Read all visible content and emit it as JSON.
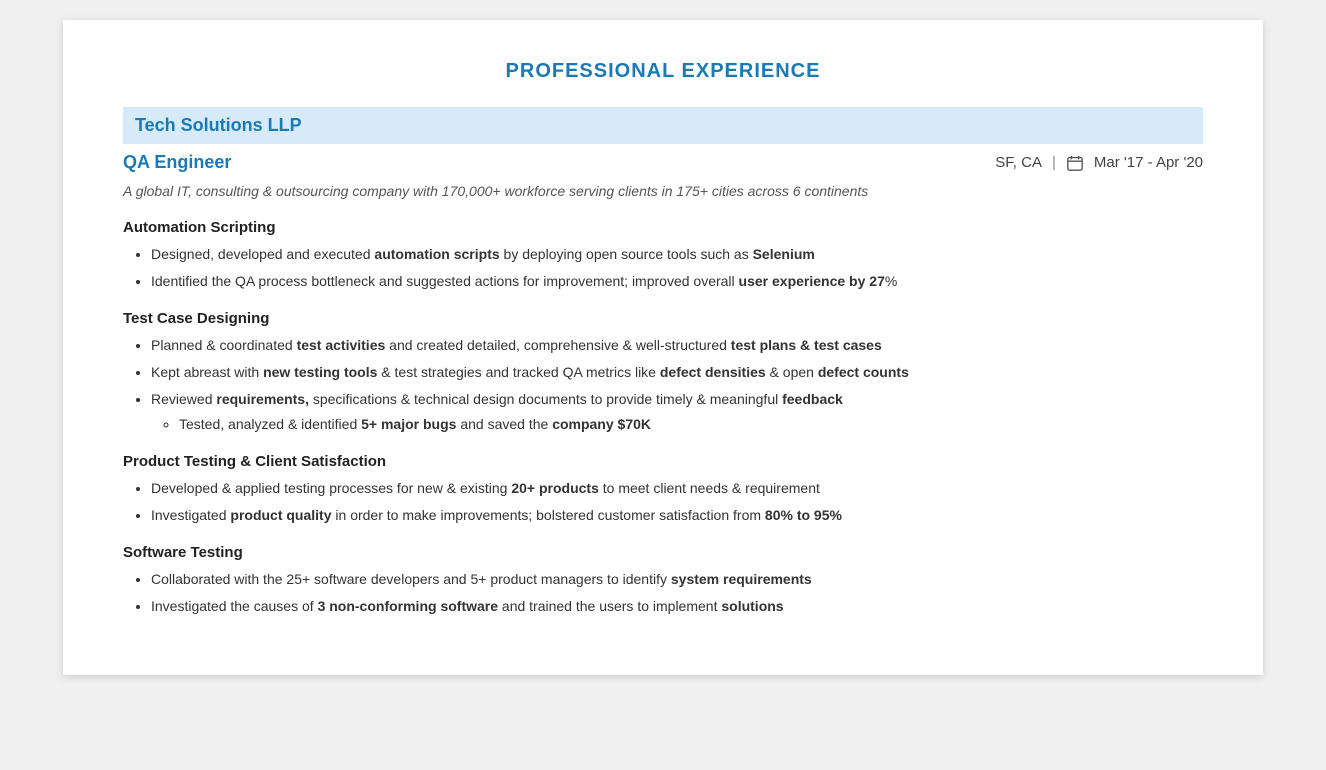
{
  "header": {
    "section_title": "PROFESSIONAL EXPERIENCE"
  },
  "company": {
    "name": "Tech Solutions LLP",
    "job_title": "QA Engineer",
    "location": "SF, CA",
    "separator": "|",
    "date_range": "Mar '17 - Apr '20",
    "description": "A global IT, consulting & outsourcing company with 170,000+ workforce serving clients in 175+ cities across 6 continents"
  },
  "skills": [
    {
      "heading": "Automation Scripting",
      "bullets": [
        {
          "text_parts": [
            {
              "text": "Designed, developed and executed ",
              "bold": false
            },
            {
              "text": "automation scripts",
              "bold": true
            },
            {
              "text": " by deploying open source tools such as ",
              "bold": false
            },
            {
              "text": "Selenium",
              "bold": true
            }
          ]
        },
        {
          "text_parts": [
            {
              "text": "Identified the QA process bottleneck and suggested actions for improvement; improved overall ",
              "bold": false
            },
            {
              "text": "user experience by 27",
              "bold": true
            },
            {
              "text": "%",
              "bold": false
            }
          ]
        }
      ],
      "sub_bullets": []
    },
    {
      "heading": "Test Case Designing",
      "bullets": [
        {
          "text_parts": [
            {
              "text": "Planned & coordinated ",
              "bold": false
            },
            {
              "text": "test activities",
              "bold": true
            },
            {
              "text": " and created detailed, comprehensive & well-structured ",
              "bold": false
            },
            {
              "text": "test plans & test cases",
              "bold": true
            }
          ]
        },
        {
          "text_parts": [
            {
              "text": "Kept abreast with ",
              "bold": false
            },
            {
              "text": "new testing tools",
              "bold": true
            },
            {
              "text": " & test strategies and tracked QA metrics like ",
              "bold": false
            },
            {
              "text": "defect densities",
              "bold": true
            },
            {
              "text": " & open ",
              "bold": false
            },
            {
              "text": "defect counts",
              "bold": true
            }
          ]
        },
        {
          "text_parts": [
            {
              "text": "Reviewed ",
              "bold": false
            },
            {
              "text": "requirements,",
              "bold": true
            },
            {
              "text": " specifications & technical design documents to provide timely & meaningful ",
              "bold": false
            },
            {
              "text": "feedback",
              "bold": true
            }
          ],
          "sub_bullets": [
            {
              "text_parts": [
                {
                  "text": "Tested, analyzed & identified ",
                  "bold": false
                },
                {
                  "text": "5+ major bugs",
                  "bold": true
                },
                {
                  "text": " and saved the ",
                  "bold": false
                },
                {
                  "text": "company $70K",
                  "bold": true
                }
              ]
            }
          ]
        }
      ]
    },
    {
      "heading": "Product Testing & Client Satisfaction",
      "bullets": [
        {
          "text_parts": [
            {
              "text": "Developed & applied testing processes for new & existing ",
              "bold": false
            },
            {
              "text": "20+ products",
              "bold": true
            },
            {
              "text": " to meet client needs & requirement",
              "bold": false
            }
          ]
        },
        {
          "text_parts": [
            {
              "text": "Investigated ",
              "bold": false
            },
            {
              "text": "product quality",
              "bold": true
            },
            {
              "text": " in order to make improvements; bolstered customer satisfaction from ",
              "bold": false
            },
            {
              "text": "80% to 95%",
              "bold": true
            }
          ]
        }
      ]
    },
    {
      "heading": "Software Testing",
      "bullets": [
        {
          "text_parts": [
            {
              "text": "Collaborated with the 25+ software developers and 5+ product managers to identify ",
              "bold": false
            },
            {
              "text": "system requirements",
              "bold": true
            }
          ]
        },
        {
          "text_parts": [
            {
              "text": "Investigated the causes of ",
              "bold": false
            },
            {
              "text": "3 non-conforming software",
              "bold": true
            },
            {
              "text": " and trained the users to implement ",
              "bold": false
            },
            {
              "text": "solutions",
              "bold": true
            }
          ]
        }
      ]
    }
  ]
}
